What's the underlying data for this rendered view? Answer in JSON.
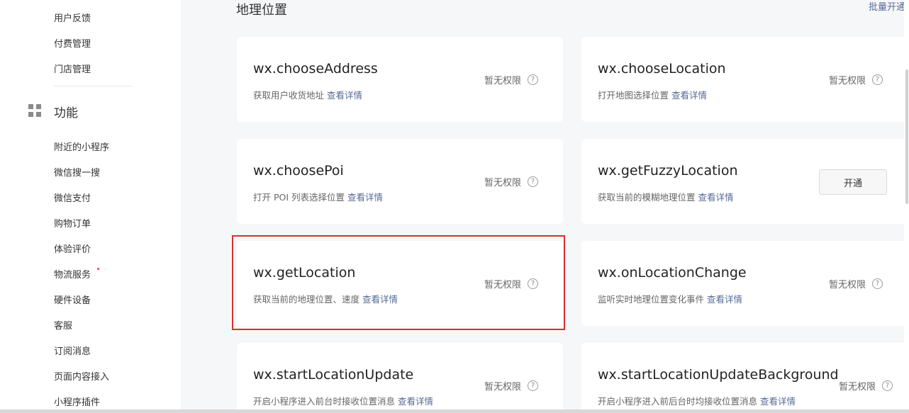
{
  "sidebar": {
    "top_items": [
      "用户反馈",
      "付费管理",
      "门店管理"
    ],
    "section": {
      "title": "功能",
      "icon": "grid-icon"
    },
    "section_items": [
      "附近的小程序",
      "微信搜一搜",
      "微信支付",
      "购物订单",
      "体验评价",
      "物流服务",
      "硬件设备",
      "客服",
      "订阅消息",
      "页面内容接入",
      "小程序插件"
    ]
  },
  "main": {
    "title": "地理位置",
    "batch_link": "批量开通",
    "no_permission_label": "暂无权限",
    "help_icon_glyph": "?",
    "detail_link": "查看详情",
    "open_button": "开通",
    "cards": [
      {
        "name": "wx.chooseAddress",
        "desc": "获取用户收货地址"
      },
      {
        "name": "wx.chooseLocation",
        "desc": "打开地图选择位置"
      },
      {
        "name": "wx.choosePoi",
        "desc": "打开 POI 列表选择位置"
      },
      {
        "name": "wx.getFuzzyLocation",
        "desc": "获取当前的模糊地理位置"
      },
      {
        "name": "wx.getLocation",
        "desc": "获取当前的地理位置、速度"
      },
      {
        "name": "wx.onLocationChange",
        "desc": "监听实时地理位置变化事件"
      },
      {
        "name": "wx.startLocationUpdate",
        "desc": "开启小程序进入前台时接收位置消息"
      },
      {
        "name": "wx.startLocationUpdateBackground",
        "desc": "开启小程序进入前后台时均接收位置消息"
      }
    ]
  },
  "colors": {
    "link": "#576b95",
    "highlight": "#d9302e",
    "badge_dot": "#e8413a"
  }
}
